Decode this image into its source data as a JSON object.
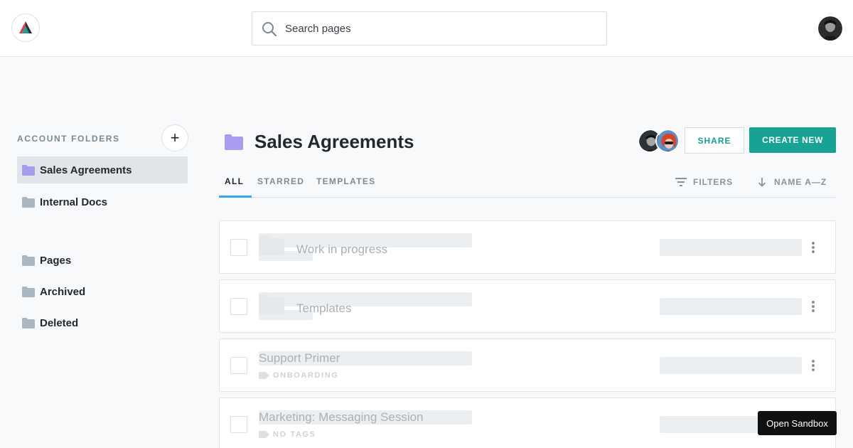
{
  "header": {
    "logo_icon": "brand-logo-icon",
    "search": {
      "placeholder": "Search pages",
      "value": ""
    },
    "user_avatar": "user-avatar"
  },
  "sidebar": {
    "heading": "ACCOUNT FOLDERS",
    "add_label": "+",
    "folders": [
      {
        "label": "Sales Agreements",
        "active": true,
        "color": "#a89cf0"
      },
      {
        "label": "Internal Docs",
        "active": false,
        "color": "#aab6c0"
      }
    ],
    "system": [
      {
        "label": "Pages",
        "color": "#aab6c0"
      },
      {
        "label": "Archived",
        "color": "#aab6c0"
      },
      {
        "label": "Deleted",
        "color": "#aab6c0"
      }
    ]
  },
  "main": {
    "title": "Sales Agreements",
    "title_folder_color": "#a89cf0",
    "share_label": "SHARE",
    "create_label": "CREATE NEW",
    "tabs": [
      {
        "label": "ALL",
        "active": true
      },
      {
        "label": "STARRED",
        "active": false
      },
      {
        "label": "TEMPLATES",
        "active": false
      }
    ],
    "filters_label": "FILTERS",
    "sort_label": "NAME A—Z",
    "rows": [
      {
        "name": "Work in progress",
        "kind": "folder",
        "tag": ""
      },
      {
        "name": "Templates",
        "kind": "folder",
        "tag": ""
      },
      {
        "name": "Support Primer",
        "kind": "page",
        "tag": "ONBOARDING"
      },
      {
        "name": "Marketing: Messaging Session",
        "kind": "page",
        "tag": "NO TAGS"
      }
    ]
  },
  "sandbox_label": "Open Sandbox",
  "colors": {
    "accent": "#17a394",
    "tab_active": "#38a8ea"
  }
}
